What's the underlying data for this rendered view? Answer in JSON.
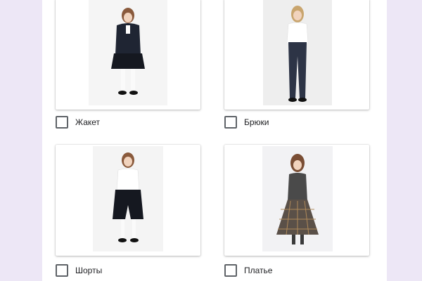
{
  "options": [
    {
      "label": "Жакет",
      "checked": false,
      "image": "girl-in-black-jacket-and-skirt"
    },
    {
      "label": "Брюки",
      "checked": false,
      "image": "girl-in-dark-trousers-and-white-blouse"
    },
    {
      "label": "Шорты",
      "checked": false,
      "image": "girl-in-black-culotte-shorts"
    },
    {
      "label": "Платье",
      "checked": false,
      "image": "girl-in-plaid-dress"
    }
  ],
  "colors": {
    "page_bg": "#ede7f6",
    "card_bg": "#ffffff",
    "checkbox_border": "#5f6368",
    "text": "#202124"
  }
}
